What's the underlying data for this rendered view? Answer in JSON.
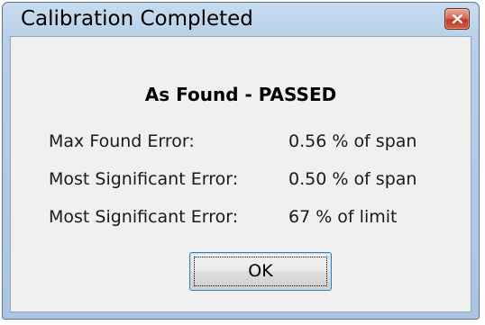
{
  "window": {
    "title": "Calibration Completed"
  },
  "icons": {
    "close": "close-icon"
  },
  "colors": {
    "frame": "#aac5e2",
    "client": "#f0f0f0",
    "close_button": "#c0392b",
    "button_focus_border": "#3c7fb1"
  },
  "dialog": {
    "heading": "As Found - PASSED",
    "results": [
      {
        "label": "Max Found Error:",
        "value": "0.56 % of span"
      },
      {
        "label": "Most Significant Error:",
        "value": "0.50 % of span"
      },
      {
        "label": "Most Significant Error:",
        "value": "67 % of limit"
      }
    ],
    "ok_label": "OK"
  }
}
